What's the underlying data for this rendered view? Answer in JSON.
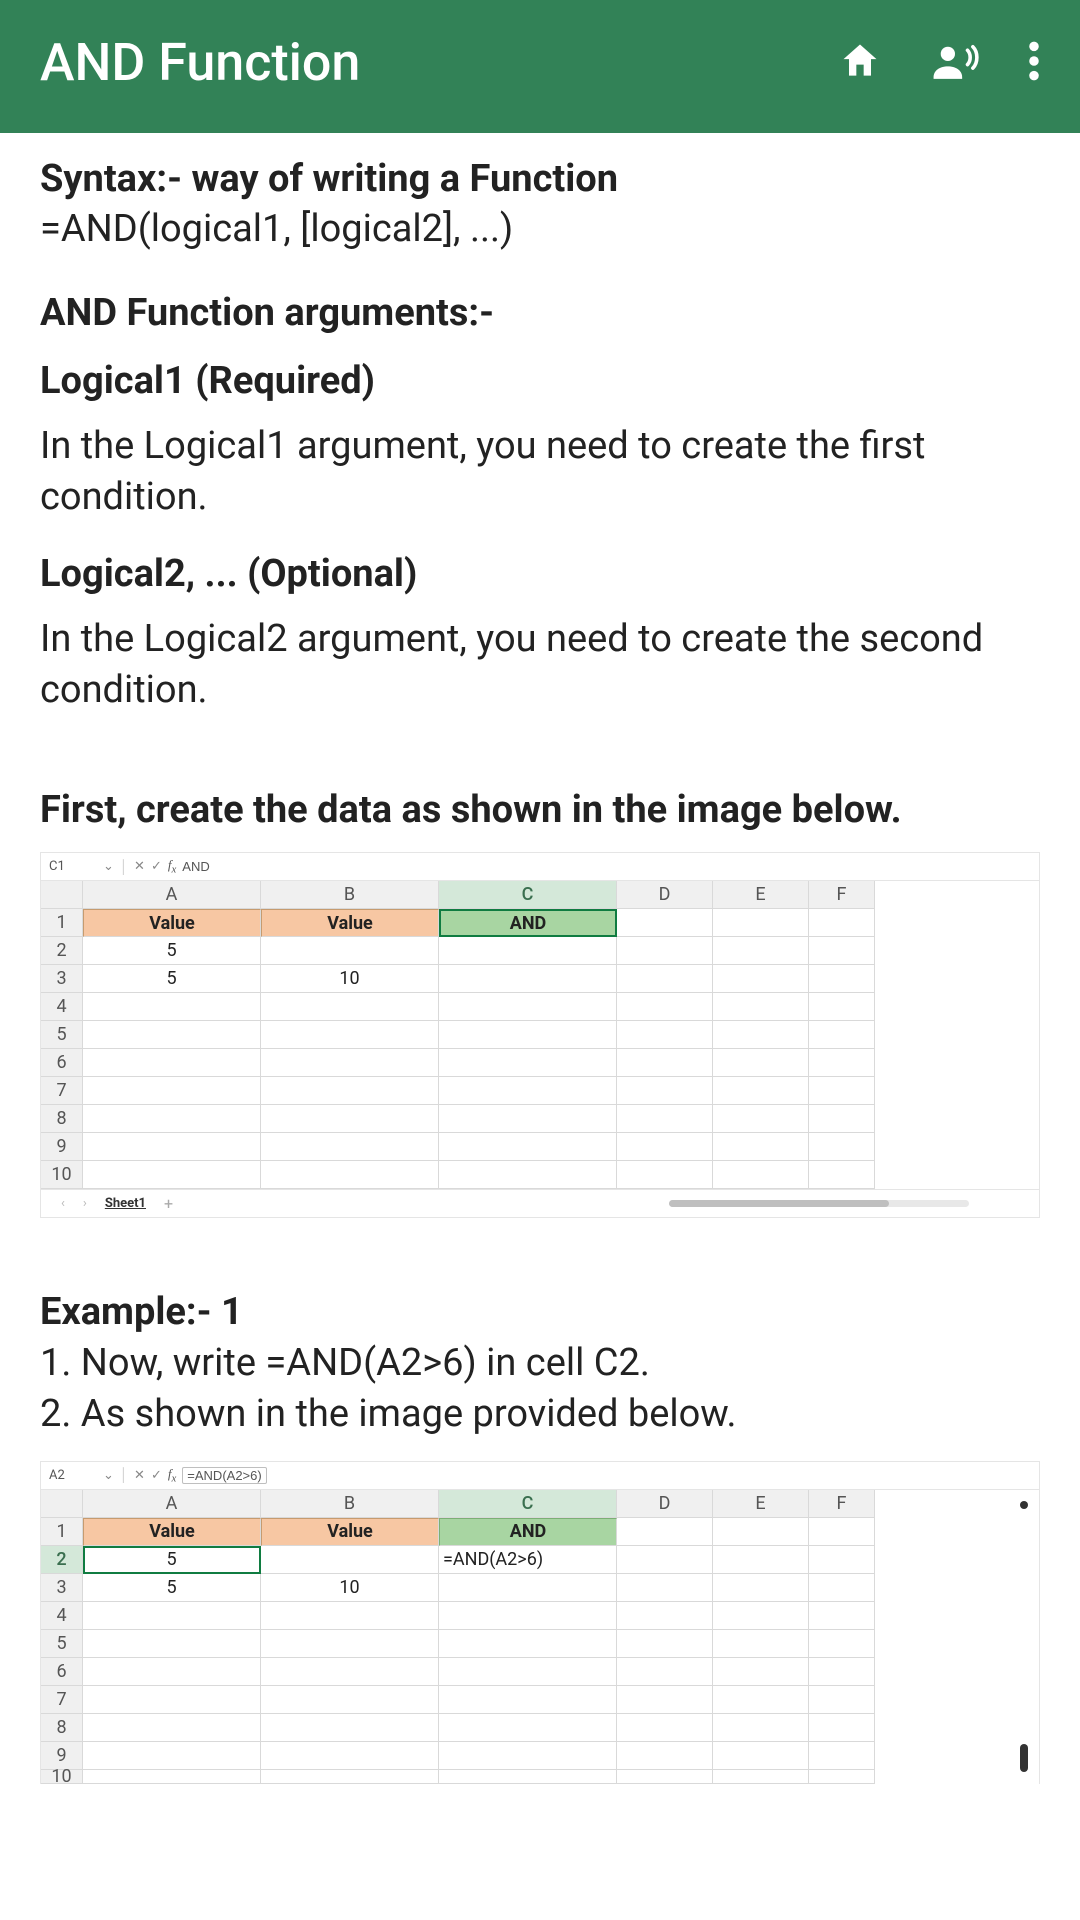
{
  "header": {
    "title": "AND Function"
  },
  "syntax": {
    "heading": "Syntax:- way of writing a Function",
    "line": "=AND(logical1, [logical2], ...)"
  },
  "args": {
    "heading": "AND Function arguments:-",
    "logical1_title": "Logical1 (Required)",
    "logical1_desc": "In the Logical1 argument, you need to create the first condition.",
    "logical2_title": "Logical2, ... (Optional)",
    "logical2_desc": "In the Logical2 argument, you need to create the second condition."
  },
  "instruction1": "First, create the data as shown in the image below.",
  "sheet1": {
    "formula_bar": {
      "cellref": "C1",
      "formula": "AND"
    },
    "col_headers": [
      "A",
      "B",
      "C",
      "D",
      "E",
      "F"
    ],
    "row_headers": [
      "1",
      "2",
      "3",
      "4",
      "5",
      "6",
      "7",
      "8",
      "9",
      "10"
    ],
    "header_cells": {
      "a1": "Value",
      "b1": "Value",
      "c1": "AND"
    },
    "data": {
      "a2": "5",
      "a3": "5",
      "b3": "10"
    },
    "tab_name": "Sheet1"
  },
  "example1": {
    "heading": "Example:- 1",
    "step1": "1. Now, write =AND(A2>6) in cell C2.",
    "step2": "2. As shown in the image provided below."
  },
  "sheet2": {
    "formula_bar": {
      "cellref": "A2",
      "formula": "=AND(A2>6)"
    },
    "col_headers": [
      "A",
      "B",
      "C",
      "D",
      "E",
      "F"
    ],
    "row_headers": [
      "1",
      "2",
      "3",
      "4",
      "5",
      "6",
      "7",
      "8",
      "9",
      "10"
    ],
    "header_cells": {
      "a1": "Value",
      "b1": "Value",
      "c1": "AND"
    },
    "data": {
      "a2": "5",
      "a3": "5",
      "b3": "10",
      "c2": "=AND(A2>6)"
    }
  }
}
